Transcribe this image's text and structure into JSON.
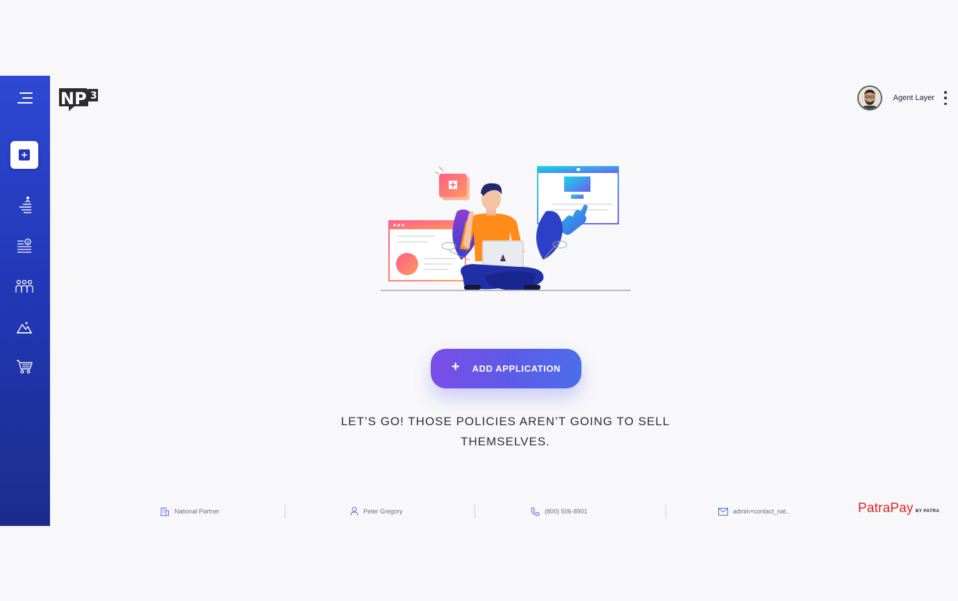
{
  "header": {
    "logo_alt": "NP3",
    "user_name": "Agent Layer"
  },
  "sidebar": {
    "items": [
      {
        "name": "menu",
        "icon": "menu-icon"
      },
      {
        "name": "add-application",
        "icon": "plus-square-icon",
        "active": true
      },
      {
        "name": "agents",
        "icon": "org-list-icon"
      },
      {
        "name": "commissions",
        "icon": "dollar-list-icon"
      },
      {
        "name": "team",
        "icon": "people-group-icon"
      },
      {
        "name": "reports",
        "icon": "mountain-chart-icon"
      },
      {
        "name": "store",
        "icon": "cart-icon"
      }
    ]
  },
  "main": {
    "add_button_label": "ADD APPLICATION",
    "add_button_icon": "+",
    "tagline": "LET’S GO! THOSE POLICIES AREN’T GOING TO SELL THEMSELVES."
  },
  "footer": {
    "partner": "National Partner",
    "contact_name": "Peter Gregory",
    "phone": "(800) 506-8901",
    "email": "admin+contact_nat..",
    "brand_name": "PatraPay",
    "brand_by": "BY PATRA"
  },
  "colors": {
    "sidebar_top": "#2f48d4",
    "sidebar_bottom": "#1c2c8c",
    "button_start": "#7a4de6",
    "button_end": "#4d6eea",
    "brand_red": "#e2242c",
    "background": "#f8f8fa"
  }
}
